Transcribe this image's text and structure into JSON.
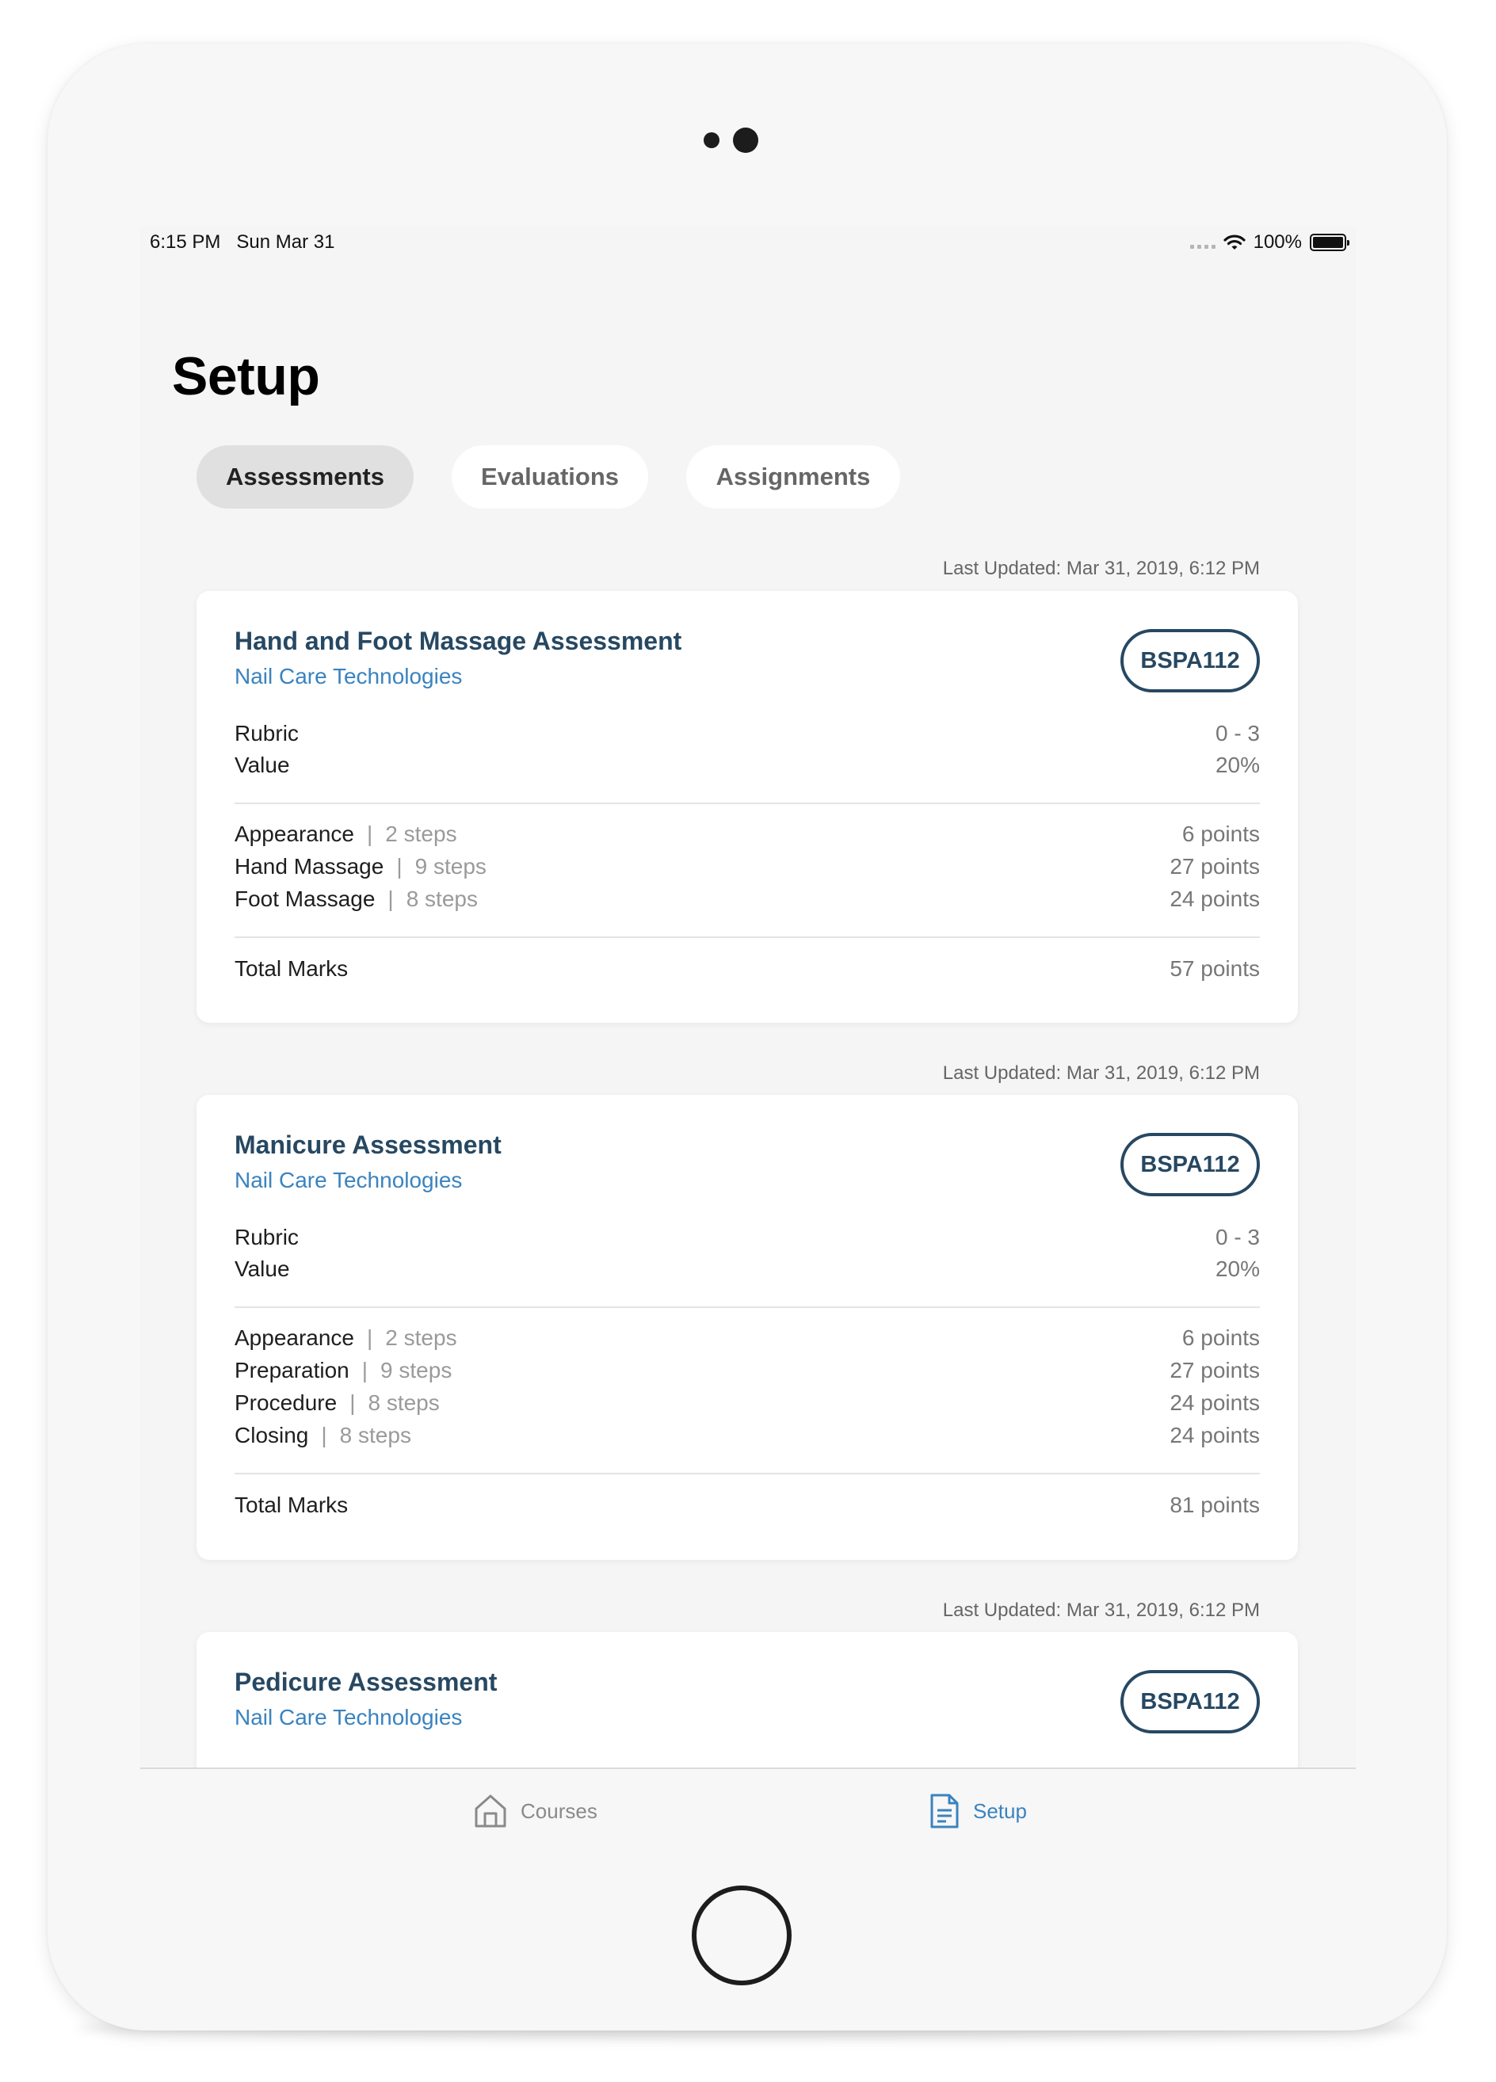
{
  "status_bar": {
    "time": "6:15 PM   Sun Mar 31",
    "battery": "100%"
  },
  "page": {
    "title": "Setup"
  },
  "tabs": [
    {
      "label": "Assessments",
      "active": true
    },
    {
      "label": "Evaluations",
      "active": false
    },
    {
      "label": "Assignments",
      "active": false
    }
  ],
  "cards": [
    {
      "last_updated": "Last Updated: Mar 31, 2019, 6:12 PM",
      "title": "Hand and Foot Massage Assessment",
      "subtitle": "Nail Care Technologies",
      "badge": "BSPA112",
      "rubric_label": "Rubric",
      "rubric_value": "0 - 3",
      "value_label": "Value",
      "value_value": "20%",
      "sections": [
        {
          "name": "Appearance",
          "steps": "2 steps",
          "points": "6 points"
        },
        {
          "name": "Hand Massage",
          "steps": "9 steps",
          "points": "27 points"
        },
        {
          "name": "Foot Massage",
          "steps": "8 steps",
          "points": "24 points"
        }
      ],
      "total_label": "Total Marks",
      "total_value": "57 points"
    },
    {
      "last_updated": "Last Updated: Mar 31, 2019, 6:12 PM",
      "title": "Manicure Assessment",
      "subtitle": "Nail Care Technologies",
      "badge": "BSPA112",
      "rubric_label": "Rubric",
      "rubric_value": "0 - 3",
      "value_label": "Value",
      "value_value": "20%",
      "sections": [
        {
          "name": "Appearance",
          "steps": "2 steps",
          "points": "6 points"
        },
        {
          "name": "Preparation",
          "steps": "9 steps",
          "points": "27 points"
        },
        {
          "name": "Procedure",
          "steps": "8 steps",
          "points": "24 points"
        },
        {
          "name": "Closing",
          "steps": "8 steps",
          "points": "24 points"
        }
      ],
      "total_label": "Total Marks",
      "total_value": "81 points"
    },
    {
      "last_updated": "Last Updated: Mar 31, 2019, 6:12 PM",
      "title": "Pedicure Assessment",
      "subtitle": "Nail Care Technologies",
      "badge": "BSPA112"
    }
  ],
  "tab_bar": {
    "courses": {
      "label": "Courses",
      "icon": "home-icon"
    },
    "setup": {
      "label": "Setup",
      "icon": "document-icon"
    }
  },
  "colors": {
    "title_navy": "#274862",
    "accent_blue": "#3a83bf",
    "screen_bg": "#f5f5f5"
  }
}
